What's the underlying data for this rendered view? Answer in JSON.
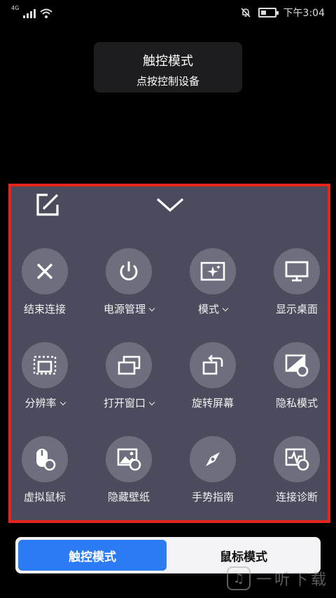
{
  "status_bar": {
    "network": "4G",
    "time": "下午3:04",
    "signal_bars": 4,
    "battery_level": 0.4
  },
  "toast": {
    "title": "触控模式",
    "subtitle": "点按控制设备"
  },
  "panel": {
    "edit_icon": "edit-icon",
    "collapse_icon": "chevron-down-icon",
    "border_color": "#e6261a",
    "items": [
      {
        "label": "结束连接",
        "icon": "close-icon",
        "has_dropdown": false
      },
      {
        "label": "电源管理",
        "icon": "power-icon",
        "has_dropdown": true
      },
      {
        "label": "模式",
        "icon": "sparkle-screen-icon",
        "has_dropdown": true
      },
      {
        "label": "显示桌面",
        "icon": "monitor-icon",
        "has_dropdown": false
      },
      {
        "label": "分辨率",
        "icon": "resolution-icon",
        "has_dropdown": true
      },
      {
        "label": "打开窗口",
        "icon": "windows-icon",
        "has_dropdown": true
      },
      {
        "label": "旋转屏幕",
        "icon": "rotate-screen-icon",
        "has_dropdown": false
      },
      {
        "label": "隐私模式",
        "icon": "privacy-icon",
        "has_dropdown": false
      },
      {
        "label": "虚拟鼠标",
        "icon": "mouse-icon",
        "has_dropdown": false
      },
      {
        "label": "隐藏壁纸",
        "icon": "wallpaper-icon",
        "has_dropdown": false
      },
      {
        "label": "手势指南",
        "icon": "compass-icon",
        "has_dropdown": false
      },
      {
        "label": "连接诊断",
        "icon": "diagnose-icon",
        "has_dropdown": false
      }
    ]
  },
  "mode_switch": {
    "active": "触控模式",
    "inactive": "鼠标模式",
    "active_color": "#2b7bf5"
  },
  "watermark": {
    "text": "一听下载"
  }
}
